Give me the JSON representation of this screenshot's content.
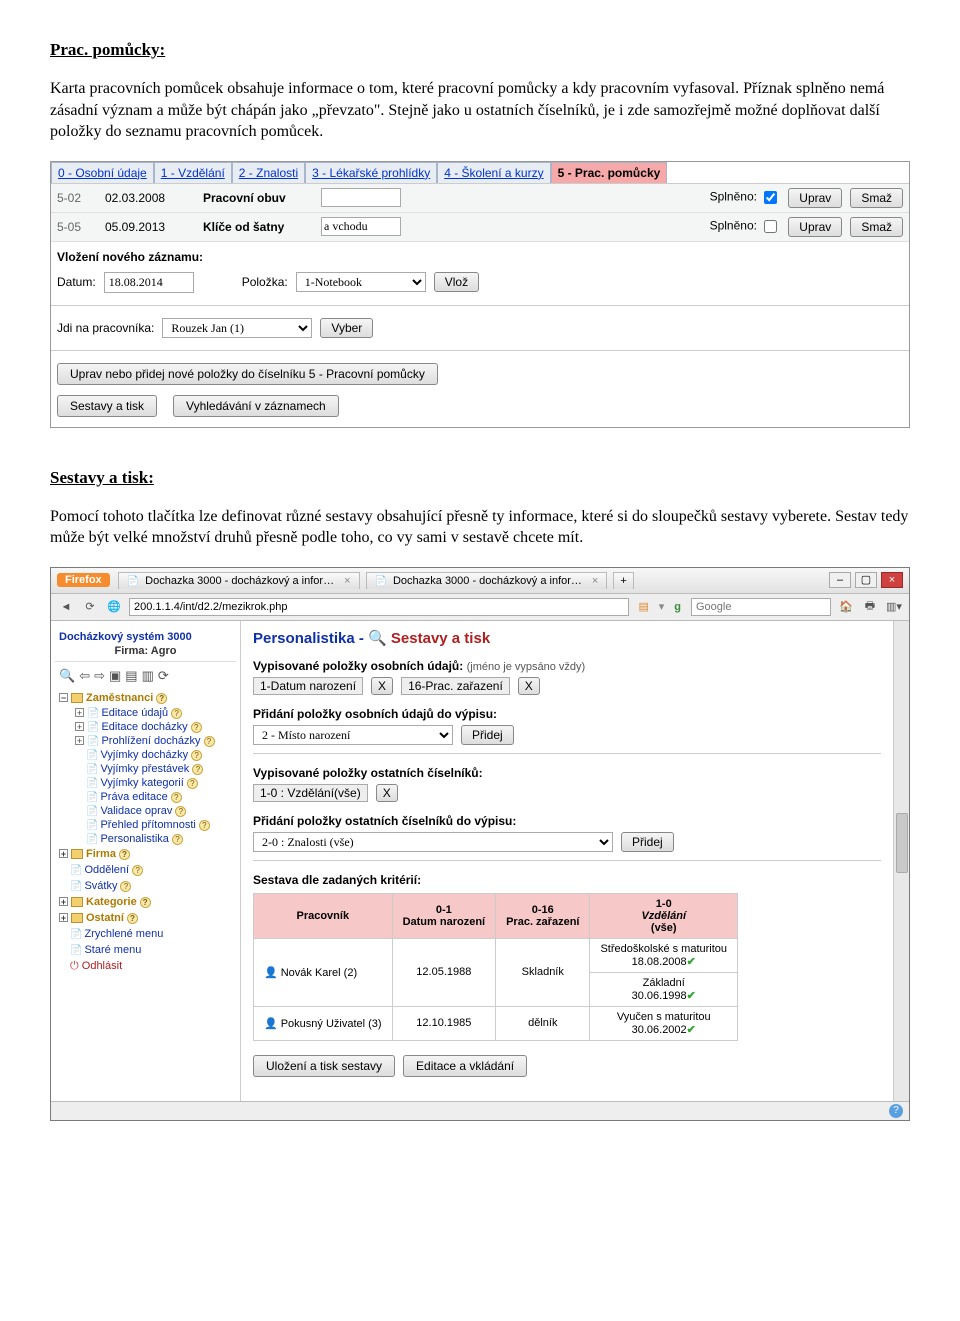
{
  "doc": {
    "h1": "Prac. pomůcky:",
    "p1": "Karta pracovních pomůcek obsahuje informace o tom, které pracovní pomůcky a kdy pracovním vyfasoval. Příznak splněno nemá zásadní význam a může být chápán jako „převzato\". Stejně jako u ostatních číselníků, je i zde samozřejmě možné doplňovat další položky do seznamu pracovních pomůcek.",
    "h2": "Sestavy a tisk:",
    "p2": "Pomocí tohoto tlačítka lze definovat různé sestavy obsahující přesně ty informace, které si do sloupečků sestavy vyberete. Sestav tedy může být velké množství druhů přesně podle toho, co vy sami v sestavě chcete mít."
  },
  "shot1": {
    "tabs": [
      {
        "label": "0 - Osobní údaje",
        "active": false
      },
      {
        "label": "1 - Vzdělání",
        "active": false
      },
      {
        "label": "2 - Znalosti",
        "active": false
      },
      {
        "label": "3 - Lékařské prohlídky",
        "active": false
      },
      {
        "label": "4 - Školení a kurzy",
        "active": false
      },
      {
        "label": "5 - Prac. pomůcky",
        "active": true
      }
    ],
    "rows": [
      {
        "code": "5-02",
        "date": "02.03.2008",
        "name": "Pracovní obuv",
        "note": "",
        "splneno": true
      },
      {
        "code": "5-05",
        "date": "05.09.2013",
        "name": "Klíče od šatny",
        "note": "a vchodu",
        "splneno": false
      }
    ],
    "splnenoLabel": "Splněno:",
    "editBtn": "Uprav",
    "deleteBtn": "Smaž",
    "newHeader": "Vložení nového záznamu:",
    "datumLabel": "Datum:",
    "datumValue": "18.08.2014",
    "polozkaLabel": "Položka:",
    "polozkaValue": "1-Notebook",
    "vlozBtn": "Vlož",
    "gotoLabel": "Jdi na pracovníka:",
    "gotoValue": "Rouzek Jan (1)",
    "vyberBtn": "Vyber",
    "editListBtn": "Uprav nebo přidej nové položky do číselníku 5 - Pracovní pomůcky",
    "reportsBtn": "Sestavy a tisk",
    "searchBtn": "Vyhledávání v záznamech"
  },
  "shot2": {
    "firefox": "Firefox",
    "tabTitle": "Dochazka 3000 - docházkový a infor…",
    "addPlus": "+",
    "url": "200.1.1.4/int/d2.2/mezikrok.php",
    "searchPlaceholder": "Google",
    "sysTitle": "Docházkový systém 3000",
    "firmLabel": "Firma:",
    "firmName": "Agro",
    "navGroup": "Zaměstnanci",
    "navItems": [
      "Editace údajů",
      "Editace docházky",
      "Prohlížení docházky",
      "Vyjímky docházky",
      "Vyjímky přestávek",
      "Vyjímky kategorií",
      "Práva editace",
      "Validace oprav",
      "Přehled přítomnosti",
      "Personalistika"
    ],
    "navGroups2": [
      "Firma",
      "Oddělení",
      "Svátky",
      "Kategorie",
      "Ostatní",
      "Zrychlené menu",
      "Staré menu",
      "Odhlásit"
    ],
    "crTitle1": "Personalistika - ",
    "crTitle2": "Sestavy a tisk",
    "sec1": "Vypisované položky osobních údajů:",
    "sec1note": "(jméno je vypsáno vždy)",
    "sec1items": [
      "1-Datum narození",
      "16-Prac. zařazení"
    ],
    "xBtn": "X",
    "sec2": "Přidání položky osobních údajů do výpisu:",
    "sec2sel": "2 - Místo narození",
    "addBtn": "Přidej",
    "sec3": "Vypisované položky ostatních číselníků:",
    "sec3item": "1-0 : Vzdělání(vše)",
    "sec4": "Přidání položky ostatních číselníků do výpisu:",
    "sec4sel": "2-0 : Znalosti (vše)",
    "sec5": "Sestava dle zadaných kritérií:",
    "tbl": {
      "headers": [
        "Pracovník",
        "0-1\nDatum narození",
        "0-16\nPrac. zařazení",
        "1-0\nVzdělání\n(vše)"
      ],
      "rows": [
        {
          "name": "Novák Karel (2)",
          "c1": "12.05.1988",
          "c2": "Skladník",
          "c3a": "Středoškolské s maturitou",
          "c3b": "18.08.2008"
        },
        {
          "name": "",
          "c1": "",
          "c2": "",
          "c3a": "Základní",
          "c3b": "30.06.1998"
        },
        {
          "name": "Pokusný Uživatel (3)",
          "c1": "12.10.1985",
          "c2": "dělník",
          "c3a": "Vyučen s maturitou",
          "c3b": "30.06.2002"
        }
      ]
    },
    "saveBtn": "Uložení a tisk sestavy",
    "editBtn": "Editace a vkládání"
  }
}
